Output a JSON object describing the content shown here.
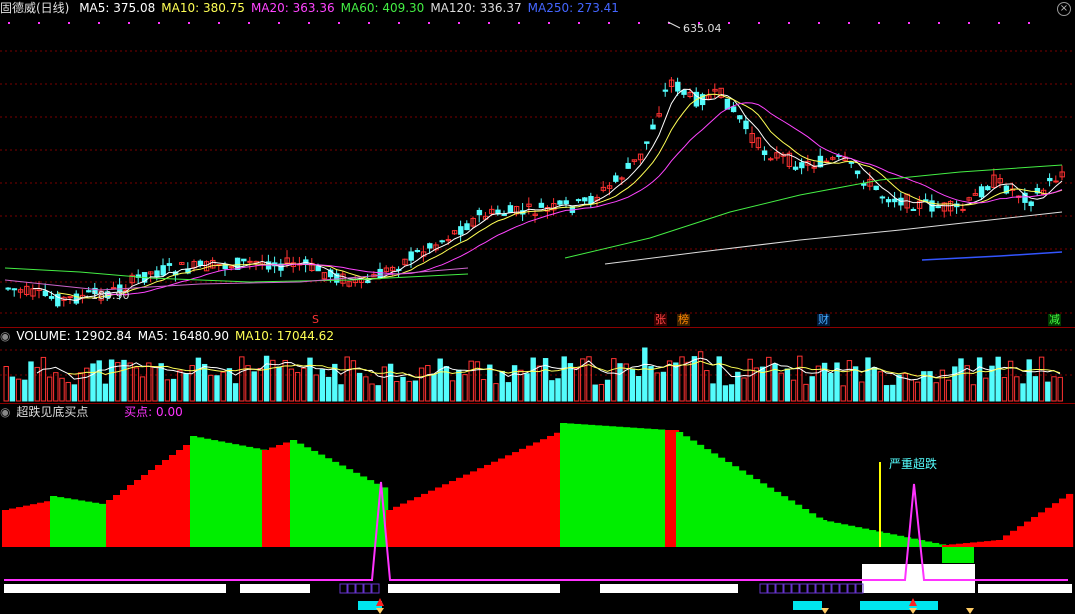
{
  "price_panel": {
    "title": "固德威(日线)",
    "indicators": [
      {
        "label": "MA5: 375.08",
        "color": "#ffffff"
      },
      {
        "label": "MA10: 380.75",
        "color": "#ffff55"
      },
      {
        "label": "MA20: 363.36",
        "color": "#ff44ff"
      },
      {
        "label": "MA60: 409.30",
        "color": "#44ee44"
      },
      {
        "label": "MA120: 336.37",
        "color": "#dddddd"
      },
      {
        "label": "MA250: 273.41",
        "color": "#4466ff"
      }
    ],
    "high_label": "635.04",
    "low_label": "180.90",
    "event_tags": [
      {
        "text": "S",
        "color": "#ff3333"
      },
      {
        "text": "张",
        "color": "#ff4444"
      },
      {
        "text": "榜",
        "color": "#ff8800"
      },
      {
        "text": "财",
        "color": "#44aaff"
      },
      {
        "text": "减",
        "color": "#44ff44"
      }
    ]
  },
  "volume_panel": {
    "indicators": [
      {
        "label": "VOLUME: 12902.84",
        "color": "#ffffff"
      },
      {
        "label": "MA5: 16480.90",
        "color": "#ffffff"
      },
      {
        "label": "MA10: 17044.62",
        "color": "#ffff55"
      }
    ]
  },
  "signal_panel": {
    "title": "超跌见底买点",
    "indicator": "买点: 0.00",
    "annotation": "严重超跌"
  },
  "colors": {
    "up": "#ff3232",
    "down": "#54fcfc",
    "bull_area": "#ff0000",
    "bear_area": "#00ee00",
    "magenta": "#ff33ff"
  }
}
